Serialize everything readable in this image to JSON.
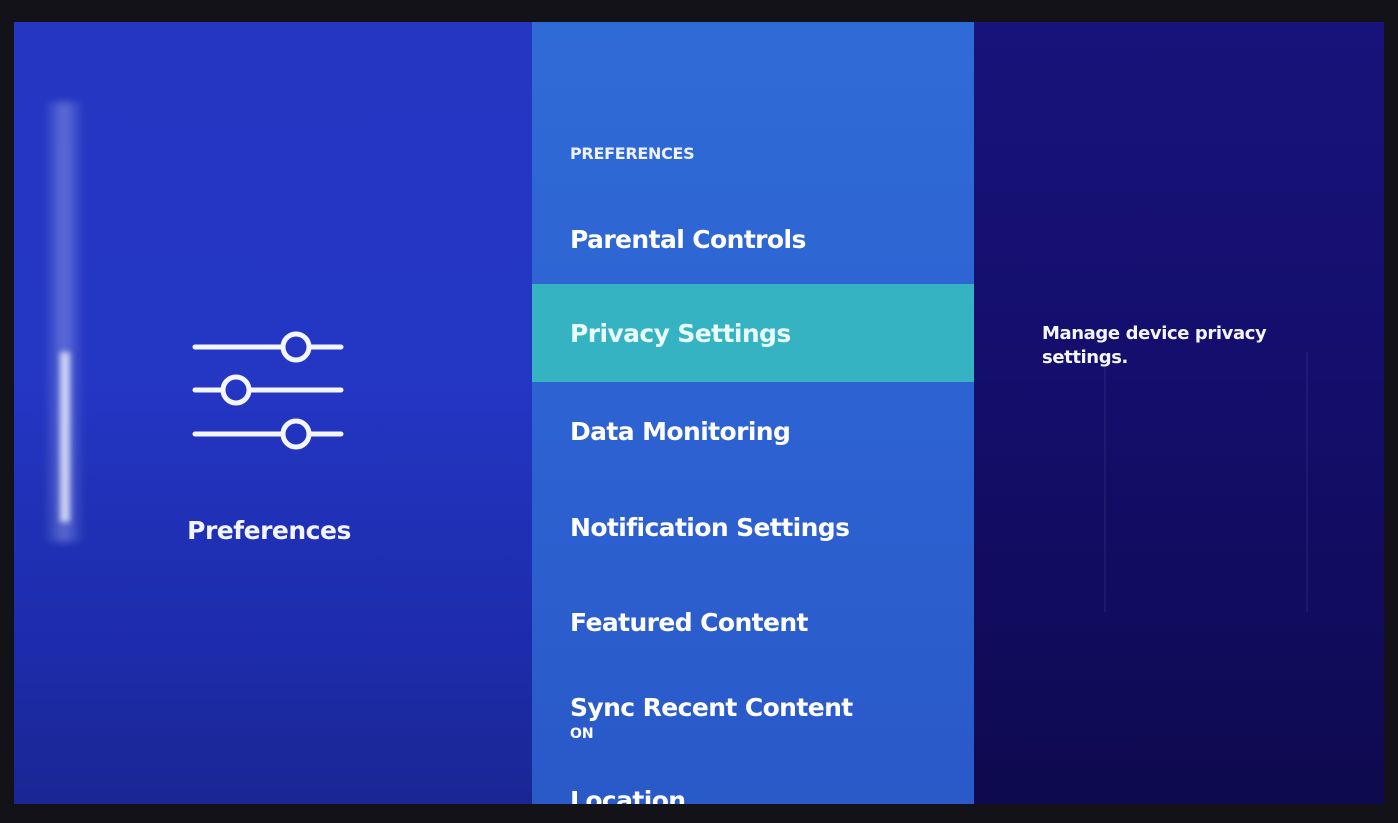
{
  "category": {
    "label": "Preferences",
    "icon": "sliders-icon"
  },
  "menu": {
    "header": "PREFERENCES",
    "items": [
      {
        "label": "Parental Controls",
        "sub": ""
      },
      {
        "label": "Privacy Settings",
        "sub": ""
      },
      {
        "label": "Data Monitoring",
        "sub": ""
      },
      {
        "label": "Notification Settings",
        "sub": ""
      },
      {
        "label": "Featured Content",
        "sub": ""
      },
      {
        "label": "Sync Recent Content",
        "sub": "ON"
      },
      {
        "label": "Location",
        "sub": ""
      }
    ],
    "selected_index": 1
  },
  "detail": {
    "description": "Manage device privacy settings."
  },
  "colors": {
    "left_panel": "#2436c2",
    "menu_panel": "#2d62d2",
    "selected_highlight": "#35b3c2",
    "right_panel": "#140f6e",
    "text": "#ffffff"
  }
}
